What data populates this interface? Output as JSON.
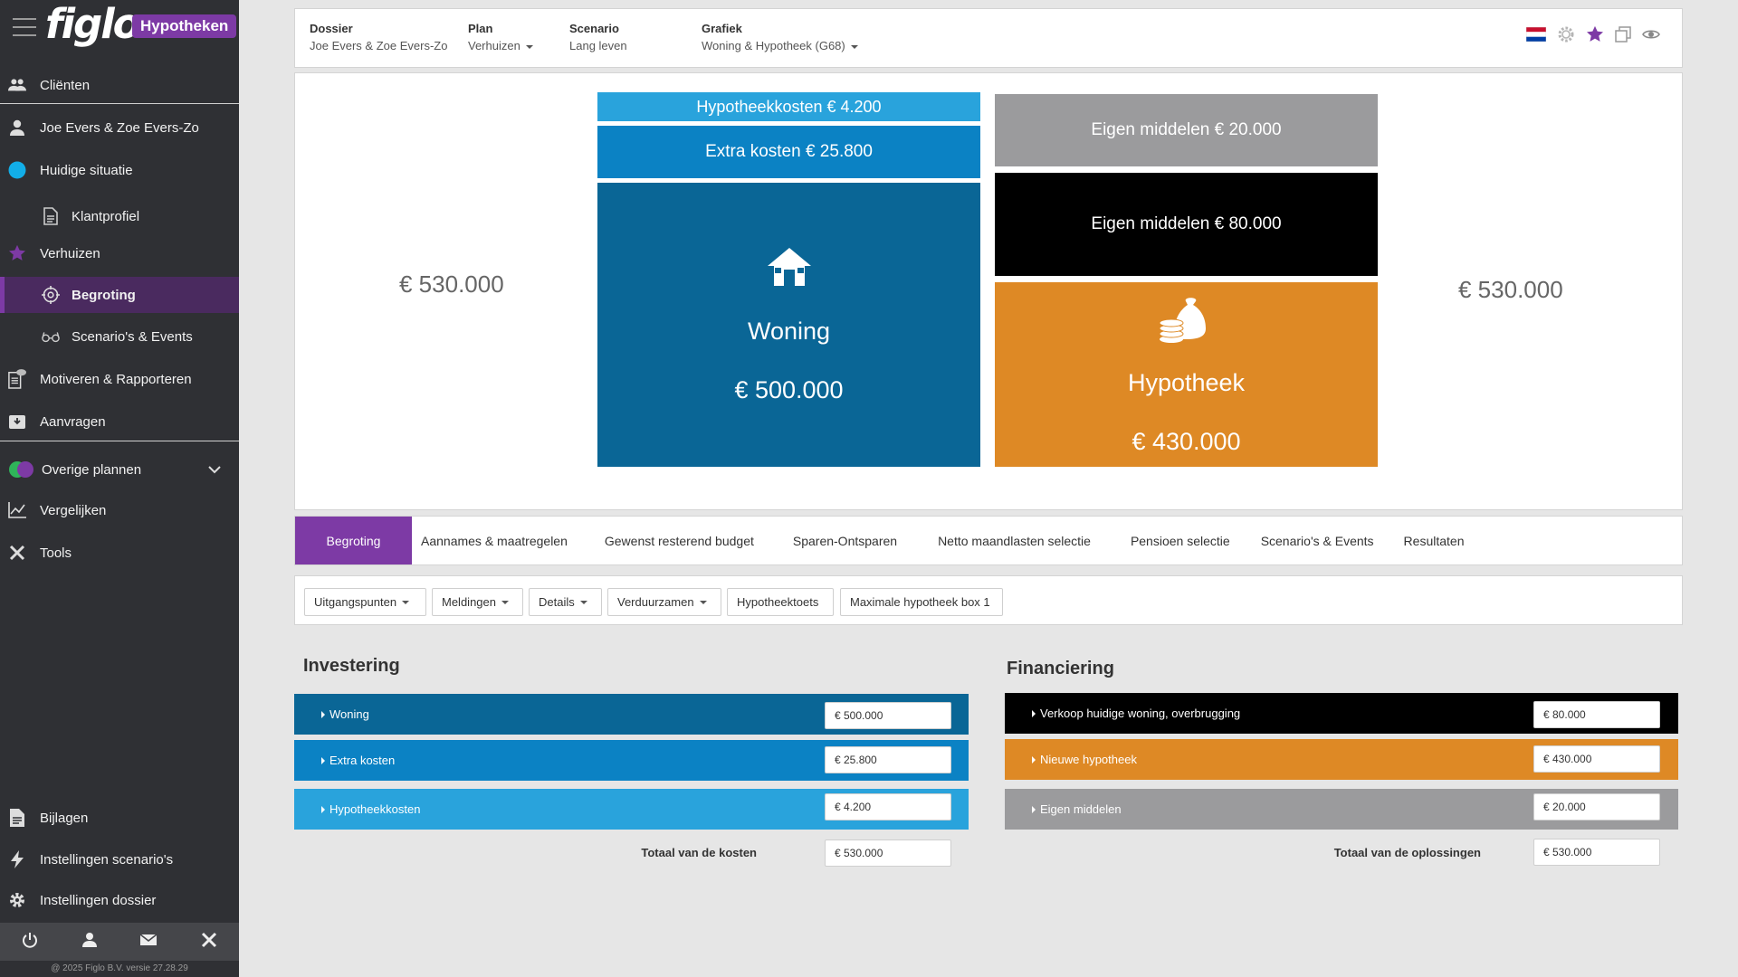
{
  "brand": {
    "logo": "figlo",
    "badge": "Hypotheken"
  },
  "sidebar": {
    "items": [
      {
        "label": "Cliënten",
        "icon": "users-icon"
      },
      {
        "label": "Joe Evers & Zoe Evers-Zo",
        "icon": "user-icon"
      },
      {
        "label": "Huidige situatie",
        "icon": "circle-icon"
      },
      {
        "label": "Klantprofiel",
        "icon": "document-icon"
      },
      {
        "label": "Verhuizen",
        "icon": "star-icon"
      },
      {
        "label": "Begroting",
        "icon": "target-icon"
      },
      {
        "label": "Scenario's & Events",
        "icon": "glasses-icon"
      },
      {
        "label": "Motiveren & Rapporteren",
        "icon": "report-icon"
      },
      {
        "label": "Aanvragen",
        "icon": "inbox-icon"
      },
      {
        "label": "Overige plannen",
        "icon": "plans-icon"
      },
      {
        "label": "Vergelijken",
        "icon": "chart-icon"
      },
      {
        "label": "Tools",
        "icon": "tools-icon"
      },
      {
        "label": "Bijlagen",
        "icon": "file-icon"
      },
      {
        "label": "Instellingen scenario's",
        "icon": "bolt-icon"
      },
      {
        "label": "Instellingen dossier",
        "icon": "gear-icon"
      }
    ],
    "copyright": "@ 2025 Figlo B.V. versie 27.28.29"
  },
  "header": {
    "dossier": {
      "label": "Dossier",
      "value": "Joe Evers & Zoe Evers-Zo"
    },
    "plan": {
      "label": "Plan",
      "value": "Verhuizen"
    },
    "scenario": {
      "label": "Scenario",
      "value": "Lang leven"
    },
    "grafiek": {
      "label": "Grafiek",
      "value": "Woning & Hypotheek (G68)"
    }
  },
  "chart": {
    "left_total": "€ 530.000",
    "right_total": "€ 530.000",
    "left_blocks": [
      {
        "label": "Hypotheekkosten € 4.200",
        "color": "#29a3dc"
      },
      {
        "label": "Extra kosten € 25.800",
        "color": "#0b82c4"
      },
      {
        "title": "Woning",
        "value": "€ 500.000",
        "color": "#0a6696"
      }
    ],
    "right_blocks": [
      {
        "label": "Eigen middelen € 20.000",
        "color": "#9b9b9d"
      },
      {
        "label": "Eigen middelen € 80.000",
        "color": "#000000"
      },
      {
        "title": "Hypotheek",
        "value": "€ 430.000",
        "color": "#de8925"
      }
    ]
  },
  "tabs": [
    "Begroting",
    "Aannames & maatregelen",
    "Gewenst resterend budget",
    "Sparen-Ontsparen",
    "Netto maandlasten selectie",
    "Pensioen selectie",
    "Scenario's & Events",
    "Resultaten"
  ],
  "toolbar": [
    "Uitgangspunten",
    "Meldingen",
    "Details",
    "Verduurzamen",
    "Hypotheektoets",
    "Maximale hypotheek box 1"
  ],
  "investering": {
    "title": "Investering",
    "rows": [
      {
        "label": "Woning",
        "value": "€ 500.000"
      },
      {
        "label": "Extra kosten",
        "value": "€ 25.800"
      },
      {
        "label": "Hypotheekkosten",
        "value": "€ 4.200"
      }
    ],
    "total_label": "Totaal van de kosten",
    "total_value": "€ 530.000"
  },
  "financiering": {
    "title": "Financiering",
    "rows": [
      {
        "label": "Verkoop huidige woning, overbrugging",
        "value": "€ 80.000"
      },
      {
        "label": "Nieuwe hypotheek",
        "value": "€ 430.000"
      },
      {
        "label": "Eigen middelen",
        "value": "€ 20.000"
      }
    ],
    "total_label": "Totaal van de oplossingen",
    "total_value": "€ 530.000"
  }
}
